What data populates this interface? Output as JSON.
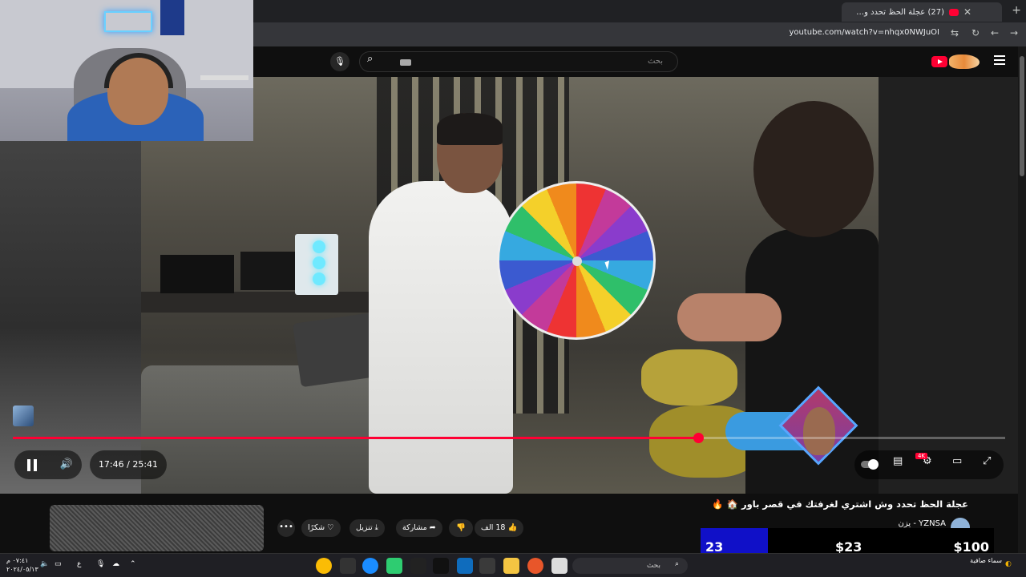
{
  "browser": {
    "tab_title": "(27) عجلة الحظ تحدد وش اش...",
    "url": "youtube.com/watch?v=nhqx0NWJuOI",
    "new_tab": "+",
    "tab_close": "✕"
  },
  "youtube": {
    "search_placeholder": "بحث",
    "video_title": "عجلة الحظ تحدد وش اشتري لغرفتك في قصر باور 🏠 🔥",
    "channel_name": "YZNSA - يزن",
    "actions": {
      "likes": "18 الف",
      "share": "مشاركة",
      "download": "تنزيل",
      "thanks": "شكرًا",
      "more": "•••"
    },
    "player": {
      "time_current": "17:46",
      "time_total": "25:41",
      "time_display": "17:46 / 25:41",
      "progress_fraction": 0.691,
      "quality_badge": "4K"
    }
  },
  "overlay": {
    "score_left": "23",
    "score_mid": "$23",
    "score_right": "$100"
  },
  "taskbar": {
    "search_label": "بحث",
    "time": "٠٧:٤١ م",
    "date": "٢٠٢٤/٠٥/١٣",
    "weather": "سماء صافية",
    "lang": "ع"
  },
  "icons": {
    "mic": "🎙",
    "search": "⌕",
    "volume": "🔊"
  }
}
